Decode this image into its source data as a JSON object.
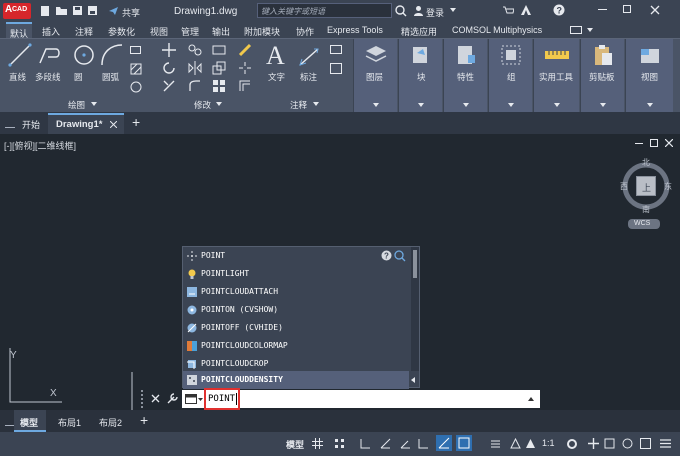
{
  "app": {
    "logo_text": "CAD",
    "share_label": "共享",
    "document_title": "Drawing1.dwg",
    "search_placeholder": "键入关键字或短语",
    "login_label": "登录"
  },
  "menu_tabs": [
    "默认",
    "插入",
    "注释",
    "参数化",
    "视图",
    "管理",
    "输出",
    "附加模块",
    "协作",
    "Express Tools",
    "精选应用",
    "COMSOL Multiphysics"
  ],
  "ribbon": {
    "draw_tools": [
      "直线",
      "多段线",
      "圆",
      "圆弧"
    ],
    "draw_panel": "绘图",
    "modify_panel": "修改",
    "annotation_tools": [
      "文字",
      "标注"
    ],
    "annotation_panel": "注释",
    "big_buttons": [
      "图层",
      "块",
      "特性",
      "组",
      "实用工具",
      "剪贴板",
      "视图"
    ]
  },
  "doc_tabs": {
    "start": "开始",
    "active": "Drawing1*"
  },
  "viewport": {
    "label": "[-][俯视][二维线框]",
    "compass": {
      "north": "北",
      "south": "南",
      "east": "东",
      "west": "西",
      "center": "上"
    },
    "wcs_label": "WCS",
    "ucs_y": "Y",
    "ucs_x": "X"
  },
  "autocomplete": {
    "items": [
      {
        "label": "POINT",
        "icon": "point-icon"
      },
      {
        "label": "POINTLIGHT",
        "icon": "lightbulb-icon"
      },
      {
        "label": "POINTCLOUDATTACH",
        "icon": "pointcloud-icon"
      },
      {
        "label": "POINTON (CVSHOW)",
        "icon": "pointcloud-show-icon"
      },
      {
        "label": "POINTOFF (CVHIDE)",
        "icon": "pointcloud-hide-icon"
      },
      {
        "label": "POINTCLOUDCOLORMAP",
        "icon": "colormap-icon"
      },
      {
        "label": "POINTCLOUDCROP",
        "icon": "crop-icon"
      },
      {
        "label": "POINTCLOUDDENSITY",
        "icon": "density-icon"
      }
    ],
    "help_icon": "help-icon",
    "search_icon": "web-search-icon"
  },
  "command_line": {
    "value": "POINT"
  },
  "layout_tabs": [
    "模型",
    "布局1",
    "布局2"
  ],
  "status": {
    "model_label": "模型",
    "scale_label": "1:1"
  },
  "colors": {
    "accent": "#6ea9e0",
    "logo_red": "#d6262b",
    "highlight_red": "#e0312f",
    "selected_row": "#55607a"
  }
}
